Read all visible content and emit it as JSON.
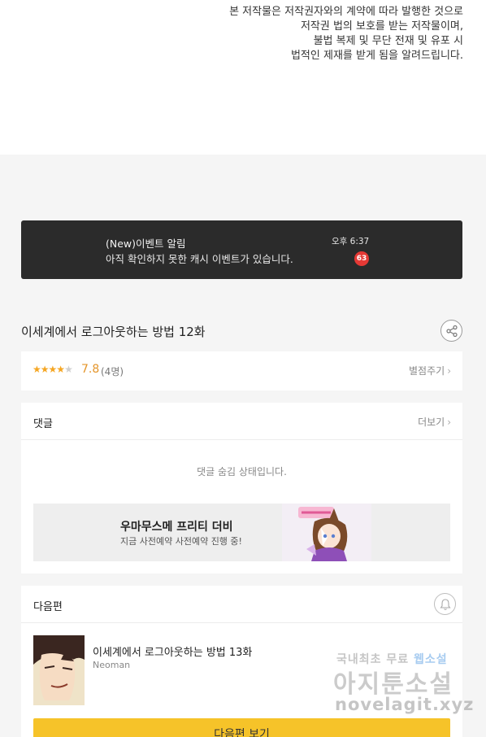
{
  "copyright": {
    "lines": [
      "본 저작물은 저작권자와의 계약에 따라 발행한 것으로",
      "저작권 법의 보호를 받는 저작물이며,",
      "불법 복제 및 무단 전재 및 유포 시",
      "법적인 제재를 받게 됨을 알려드립니다."
    ]
  },
  "notification": {
    "title": "(New)이벤트 알림",
    "message": "아직 확인하지 못한 캐시 이벤트가 있습니다.",
    "time": "오후 6:37",
    "badge_count": "63"
  },
  "episode": {
    "title": "이세계에서 로그아웃하는 방법 12화",
    "share_icon": "share-icon"
  },
  "rating": {
    "stars_filled": 4,
    "stars_total": 5,
    "score": "7.8",
    "count": "(4명)",
    "rate_link": "별점주기"
  },
  "comments": {
    "label": "댓글",
    "more_link": "더보기",
    "hidden_message": "댓글 숨김 상태입니다."
  },
  "ad": {
    "title": "우마무스메 프리티 더비",
    "subtitle": "지금 사전예약 사전예약 진행 중!"
  },
  "next_episode": {
    "label": "다음편",
    "title": "이세계에서 로그아웃하는 방법 13화",
    "author": "Neoman",
    "button_label": "다음편 보기",
    "bell_icon": "bell-icon"
  },
  "watermark": {
    "line1_gray": "국내최초 무료 ",
    "line1_blue": "웹소설",
    "line2": "아지툰소설",
    "line3": "novelagit.xyz"
  },
  "colors": {
    "accent_yellow": "#f6c329",
    "star_orange": "#f5a623",
    "badge_red": "#e53935",
    "banner_bg": "#2b2b2b"
  }
}
